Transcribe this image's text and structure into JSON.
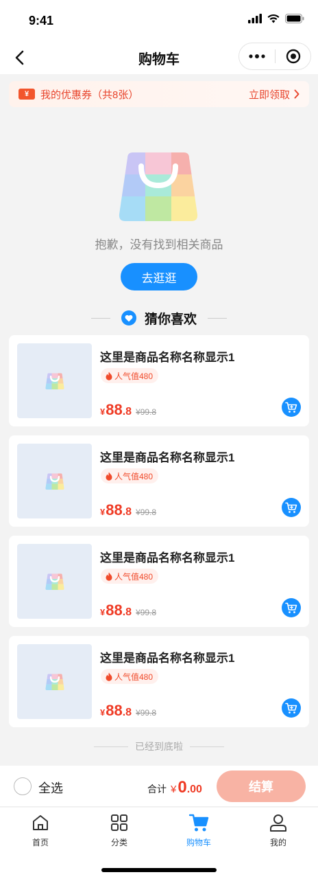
{
  "status_bar": {
    "time": "9:41"
  },
  "nav": {
    "title": "购物车"
  },
  "coupon": {
    "icon_text": "¥",
    "text": "我的优惠券（共8张）",
    "action": "立即领取"
  },
  "empty": {
    "message": "抱歉，没有找到相关商品",
    "button": "去逛逛"
  },
  "recommend": {
    "title": "猜你喜欢"
  },
  "products": [
    {
      "name": "这里是商品名称名称显示1",
      "popularity": "人气值480",
      "currency": "¥",
      "price_int": "88",
      "price_dec": ".8",
      "original_price": "¥99.8"
    },
    {
      "name": "这里是商品名称名称显示1",
      "popularity": "人气值480",
      "currency": "¥",
      "price_int": "88",
      "price_dec": ".8",
      "original_price": "¥99.8"
    },
    {
      "name": "这里是商品名称名称显示1",
      "popularity": "人气值480",
      "currency": "¥",
      "price_int": "88",
      "price_dec": ".8",
      "original_price": "¥99.8"
    },
    {
      "name": "这里是商品名称名称显示1",
      "popularity": "人气值480",
      "currency": "¥",
      "price_int": "88",
      "price_dec": ".8",
      "original_price": "¥99.8"
    }
  ],
  "end_note": "已经到底啦",
  "checkout": {
    "select_all": "全选",
    "total_label": "合计",
    "currency": "¥",
    "total_int": "0",
    "total_dec": ".00",
    "button": "结算"
  },
  "tabbar": [
    {
      "label": "首页",
      "icon": "home-icon",
      "active": false
    },
    {
      "label": "分类",
      "icon": "category-icon",
      "active": false
    },
    {
      "label": "购物车",
      "icon": "cart-icon",
      "active": true
    },
    {
      "label": "我的",
      "icon": "user-icon",
      "active": false
    }
  ],
  "colors": {
    "primary": "#1890ff",
    "price": "#ef3a24",
    "checkout_button": "#f8b3a4"
  }
}
